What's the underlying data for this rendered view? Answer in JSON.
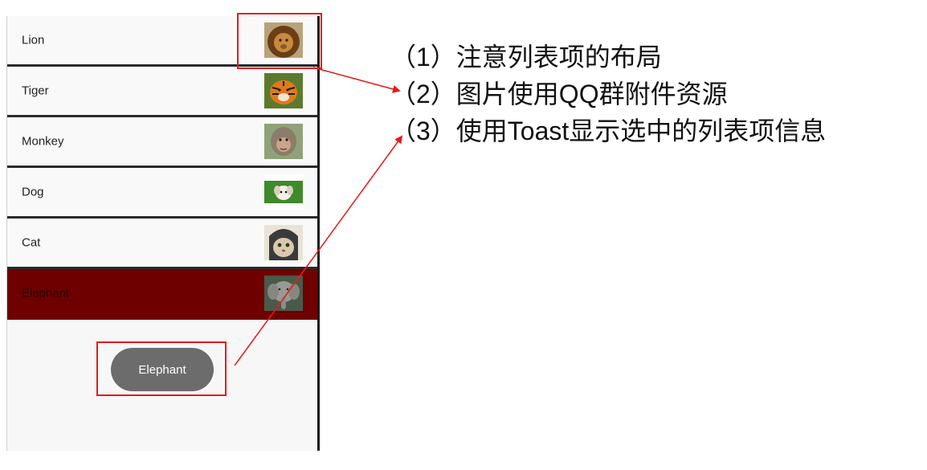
{
  "list": {
    "items": [
      {
        "label": "Lion",
        "image": "lion-photo"
      },
      {
        "label": "Tiger",
        "image": "tiger-photo"
      },
      {
        "label": "Monkey",
        "image": "monkey-photo"
      },
      {
        "label": "Dog",
        "image": "dog-photo"
      },
      {
        "label": "Cat",
        "image": "cat-photo"
      },
      {
        "label": "Elephant",
        "image": "elephant-photo",
        "selected": true
      }
    ],
    "selected_color": "#6e0000"
  },
  "toast": {
    "text": "Elephant"
  },
  "notes": [
    "（1）注意列表项的布局",
    "（2）图片使用QQ群附件资源",
    "（3）使用Toast显示选中的列表项信息"
  ],
  "colors": {
    "highlight": "#e41b1b"
  }
}
